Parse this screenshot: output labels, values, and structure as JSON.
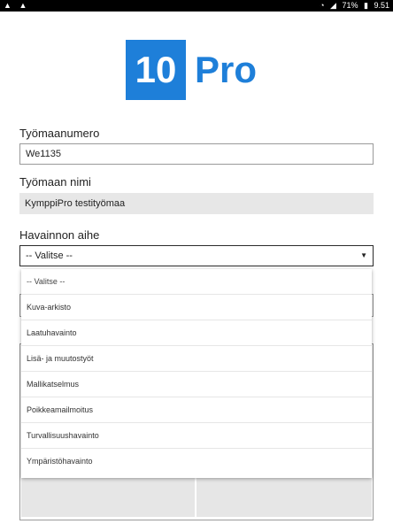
{
  "status_bar": {
    "left_icons": [
      "warning-icon",
      "warning-icon"
    ],
    "battery": "71%",
    "time": "9.51"
  },
  "logo": {
    "number": "10",
    "text": "Pro",
    "color": "#1e7fd9"
  },
  "form": {
    "site_number_label": "Työmaanumero",
    "site_number_value": "We1135",
    "site_name_label": "Työmaan nimi",
    "site_name_value": "KymppiPro testityömaa",
    "topic_label": "Havainnon aihe",
    "topic_selected": "-- Valitse --"
  },
  "dropdown": {
    "options": [
      "-- Valitse --",
      "Kuva-arkisto",
      "Laatuhavainto",
      "Lisä- ja muutostyöt",
      "Mallikatselmus",
      "Poikkeamailmoitus",
      "Turvallisuushavainto",
      "Ympäristöhavainto"
    ]
  }
}
